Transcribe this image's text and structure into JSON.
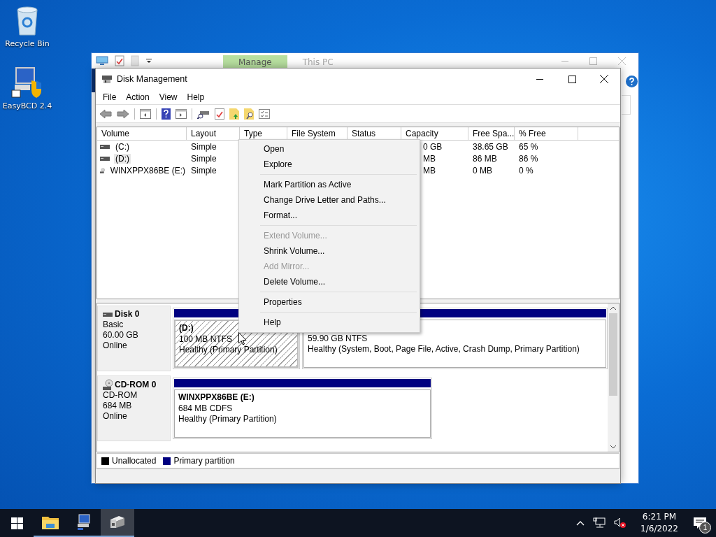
{
  "desktop_icons": [
    {
      "label": "Recycle Bin",
      "kind": "recycle"
    },
    {
      "label": "EasyBCD 2.4",
      "kind": "easybcd"
    }
  ],
  "background_window": {
    "ribbon_tabs": [
      {
        "label": "Manage",
        "selected": true
      },
      {
        "label": "This PC",
        "selected": false
      }
    ]
  },
  "window": {
    "title": "Disk Management"
  },
  "menu_bar": [
    "File",
    "Action",
    "View",
    "Help"
  ],
  "volume_table": {
    "columns": [
      "Volume",
      "Layout",
      "Type",
      "File System",
      "Status",
      "Capacity",
      "Free Spa...",
      "% Free"
    ],
    "rows": [
      {
        "volume": "(C:)",
        "kind": "disk",
        "layout": "Simple",
        "capacity": "0 GB",
        "free_space": "38.65 GB",
        "percent_free": "65 %",
        "selected": false
      },
      {
        "volume": "(D:)",
        "kind": "disk",
        "layout": "Simple",
        "capacity": "MB",
        "free_space": "86 MB",
        "percent_free": "86 %",
        "selected": true
      },
      {
        "volume": "WINXPPX86BE (E:)",
        "kind": "cdrom",
        "layout": "Simple",
        "capacity": "MB",
        "free_space": "0 MB",
        "percent_free": "0 %",
        "selected": false
      }
    ]
  },
  "disks": [
    {
      "name": "Disk 0",
      "kind": "disk",
      "type": "Basic",
      "size": "60.00 GB",
      "status": "Online",
      "partitions": [
        {
          "title": "(D:)",
          "size": "100 MB NTFS",
          "health": "Healthy (Primary Partition)",
          "selected": true
        },
        {
          "size": "59.90 GB NTFS",
          "health": "Healthy (System, Boot, Page File, Active, Crash Dump, Primary Partition)",
          "selected": false
        }
      ]
    },
    {
      "name": "CD-ROM 0",
      "kind": "cdrom",
      "type": "CD-ROM",
      "size": "684 MB",
      "status": "Online",
      "partitions": [
        {
          "title": "WINXPPX86BE  (E:)",
          "size": "684 MB CDFS",
          "health": "Healthy (Primary Partition)",
          "selected": false
        }
      ]
    }
  ],
  "legend": [
    {
      "label": "Unallocated",
      "color": "#000000"
    },
    {
      "label": "Primary partition",
      "color": "#000080"
    }
  ],
  "context_menu": {
    "items": [
      {
        "kind": "item",
        "label": "Open",
        "disabled": false
      },
      {
        "kind": "item",
        "label": "Explore",
        "disabled": false
      },
      {
        "kind": "separator"
      },
      {
        "kind": "item",
        "label": "Mark Partition as Active",
        "disabled": false
      },
      {
        "kind": "item",
        "label": "Change Drive Letter and Paths...",
        "disabled": false
      },
      {
        "kind": "item",
        "label": "Format...",
        "disabled": false
      },
      {
        "kind": "separator"
      },
      {
        "kind": "item",
        "label": "Extend Volume...",
        "disabled": true
      },
      {
        "kind": "item",
        "label": "Shrink Volume...",
        "disabled": false
      },
      {
        "kind": "item",
        "label": "Add Mirror...",
        "disabled": true
      },
      {
        "kind": "item",
        "label": "Delete Volume...",
        "disabled": false
      },
      {
        "kind": "separator"
      },
      {
        "kind": "item",
        "label": "Properties",
        "disabled": false
      },
      {
        "kind": "separator"
      },
      {
        "kind": "item",
        "label": "Help",
        "disabled": false
      }
    ]
  },
  "taskbar": {
    "apps": [
      {
        "kind": "explorer",
        "selected": false
      },
      {
        "kind": "easybcd",
        "selected": false
      },
      {
        "kind": "diskmgmt",
        "selected": true
      }
    ],
    "tray": {
      "time": "6:21 PM",
      "date": "1/6/2022",
      "notification_count": "1"
    }
  }
}
